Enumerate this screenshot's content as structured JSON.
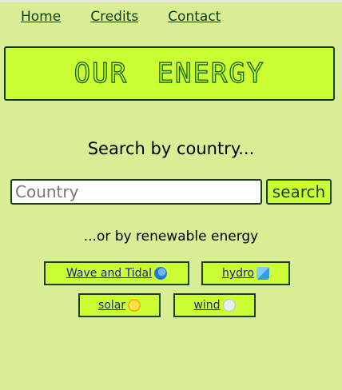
{
  "nav": {
    "links": [
      {
        "label": "Home"
      },
      {
        "label": "Credits"
      },
      {
        "label": "Contact"
      }
    ]
  },
  "banner": {
    "title": "OUR ENERGY"
  },
  "search": {
    "heading": "Search by country...",
    "placeholder": "Country",
    "value": "",
    "button_label": "search"
  },
  "renewables": {
    "heading": "...or by renewable energy",
    "buttons": [
      {
        "label": "Wave and Tidal",
        "icon": "wave-icon"
      },
      {
        "label": "hydro",
        "icon": "water-droplet-icon"
      },
      {
        "label": "solar",
        "icon": "sun-icon"
      },
      {
        "label": "wind",
        "icon": "wind-icon"
      }
    ]
  },
  "colors": {
    "background": "#d9ed94",
    "accent": "#ccff33",
    "border": "#1d3d1d",
    "link": "#1a1a99"
  }
}
